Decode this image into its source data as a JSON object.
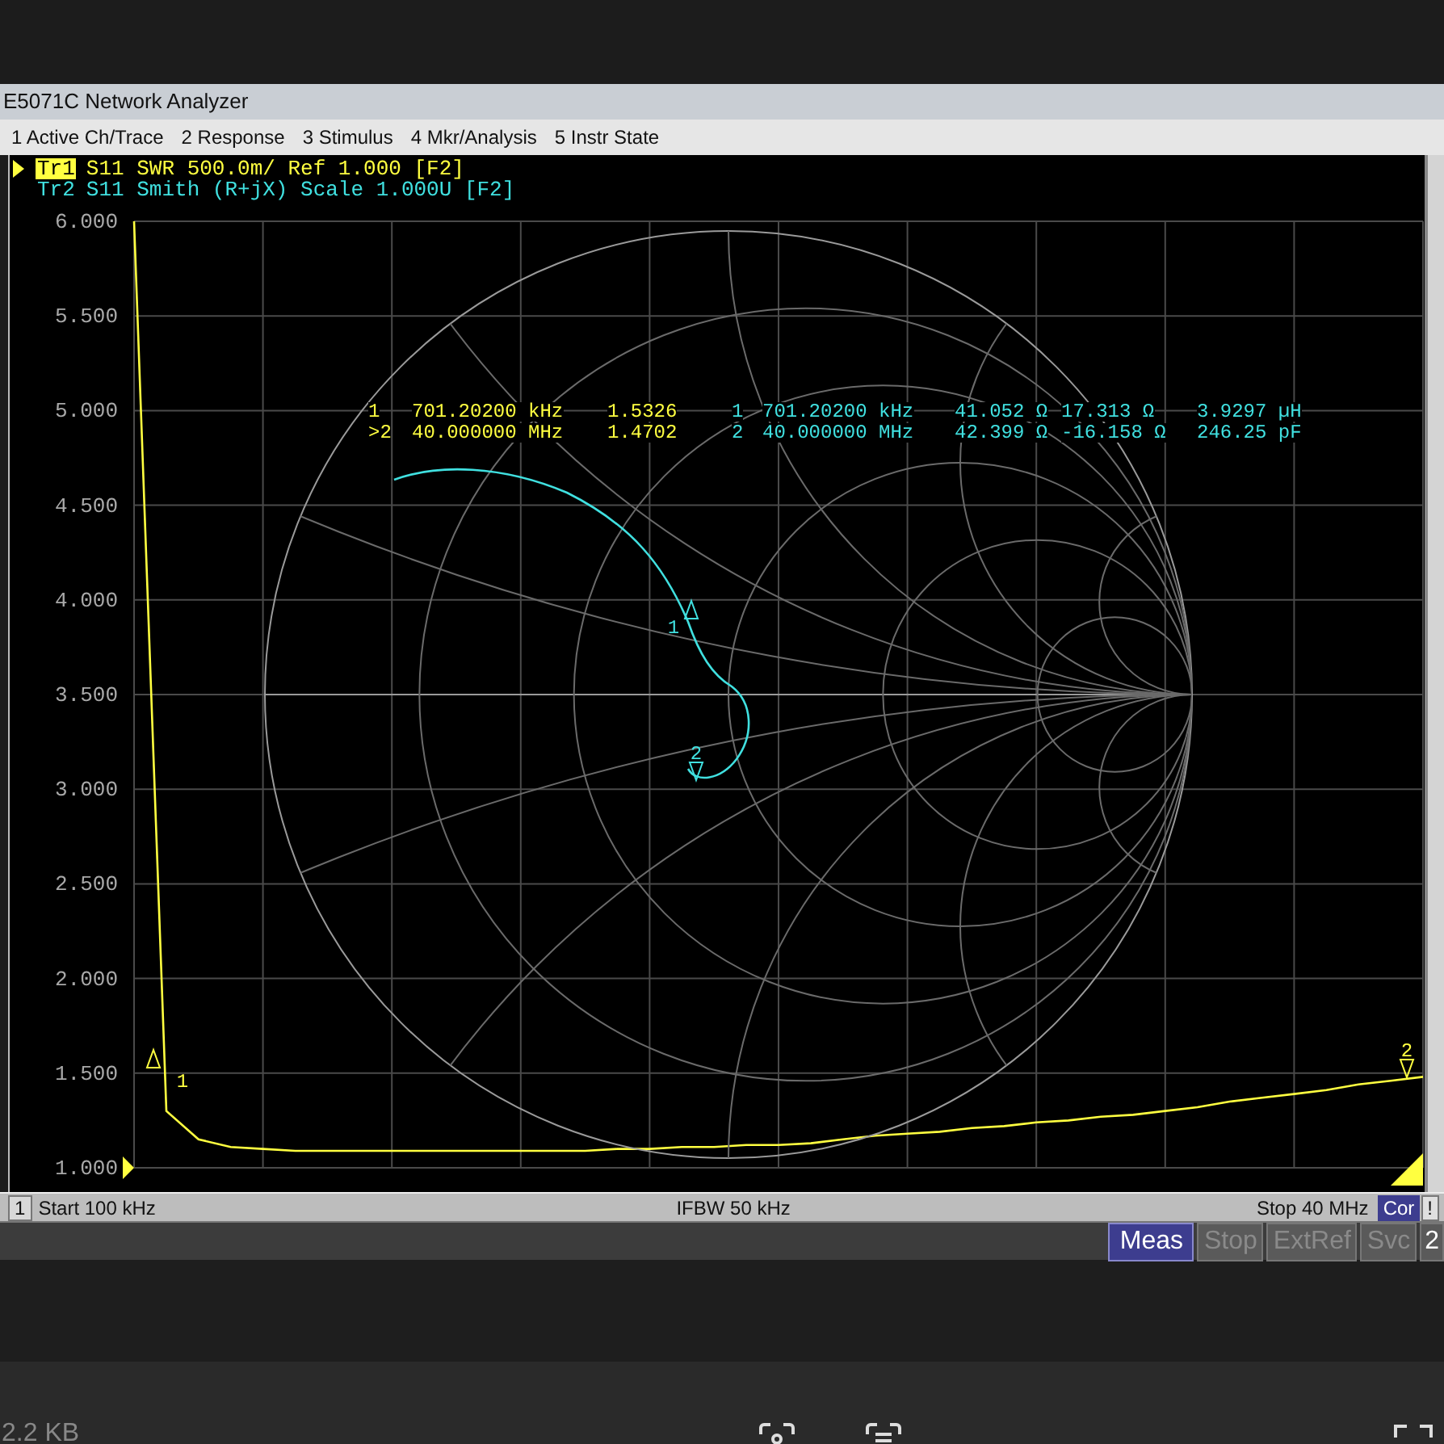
{
  "window": {
    "title": "E5071C Network Analyzer"
  },
  "menu": [
    {
      "label": "1 Active Ch/Trace"
    },
    {
      "label": "2 Response"
    },
    {
      "label": "3 Stimulus"
    },
    {
      "label": "4 Mkr/Analysis"
    },
    {
      "label": "5 Instr State"
    }
  ],
  "traces": [
    {
      "label": "Tr1",
      "text": "S11 SWR 500.0m/ Ref 1.000 [F2]",
      "selected": true,
      "color": "#ffff40"
    },
    {
      "label": "Tr2",
      "text": "S11 Smith (R+jX) Scale 1.000U [F2]",
      "selected": false,
      "color": "#40e0e0"
    }
  ],
  "tr1_markers": [
    {
      "number": "1",
      "frequency": "701.20200 kHz",
      "value": "1.5326"
    },
    {
      "number": ">2",
      "frequency": "40.000000 MHz",
      "value": "1.4702"
    }
  ],
  "tr2_markers": [
    {
      "number": "1",
      "frequency": "701.20200 kHz",
      "resistance": "41.052 Ω",
      "reactance": "17.313 Ω",
      "equivalent": "3.9297 µH"
    },
    {
      "number": "2",
      "frequency": "40.000000 MHz",
      "resistance": "42.399 Ω",
      "reactance": "-16.158 Ω",
      "equivalent": "246.25 pF"
    }
  ],
  "swr_chart": {
    "chart_data": {
      "type": "line",
      "grid": true,
      "ylim": [
        1,
        6
      ],
      "yticks": [
        {
          "value": 1,
          "label": "1.000"
        },
        {
          "value": 1.5,
          "label": "1.500"
        },
        {
          "value": 2,
          "label": "2.000"
        },
        {
          "value": 2.5,
          "label": "2.500"
        },
        {
          "value": 3,
          "label": "3.000"
        },
        {
          "value": 3.5,
          "label": "3.500"
        },
        {
          "value": 4,
          "label": "4.000"
        },
        {
          "value": 4.5,
          "label": "4.500"
        },
        {
          "value": 5,
          "label": "5.000"
        },
        {
          "value": 5.5,
          "label": "5.500"
        },
        {
          "value": 6,
          "label": "6.000"
        }
      ],
      "categories": [
        null,
        null,
        null,
        null,
        null,
        null,
        null,
        null,
        null,
        null,
        null,
        null,
        null,
        null,
        null,
        null,
        null,
        null,
        null,
        null,
        null,
        null,
        null,
        null,
        null,
        null,
        null,
        null,
        null,
        null,
        null,
        null,
        null,
        null,
        null,
        null,
        null,
        null,
        null,
        null,
        null
      ],
      "series": [
        {
          "color": "#ffff40",
          "values": [
            6.0,
            1.3,
            1.15,
            1.11,
            1.1,
            1.09,
            1.09,
            1.09,
            1.09,
            1.09,
            1.09,
            1.09,
            1.09,
            1.09,
            1.09,
            1.1,
            1.1,
            1.11,
            1.11,
            1.12,
            1.12,
            1.13,
            1.15,
            1.17,
            1.18,
            1.19,
            1.21,
            1.22,
            1.24,
            1.25,
            1.27,
            1.28,
            1.3,
            1.32,
            1.35,
            1.37,
            1.39,
            1.41,
            1.44,
            1.46,
            1.48
          ]
        }
      ]
    },
    "marker_labels": [
      "1",
      "2"
    ]
  },
  "smith_chart": {
    "marker_labels": [
      "1",
      "2"
    ]
  },
  "status_bar": {
    "channel": "1",
    "start": "Start 100 kHz",
    "ifbw": "IFBW 50 kHz",
    "stop": "Stop 40 MHz",
    "correction": "Cor",
    "alert": "!"
  },
  "instrument_bar": {
    "buttons": [
      {
        "label": "Meas",
        "selected": true
      },
      {
        "label": "Stop",
        "selected": false
      },
      {
        "label": "ExtRef",
        "selected": false
      },
      {
        "label": "Svc",
        "selected": false
      }
    ],
    "trailing": "2"
  },
  "viewer": {
    "file_size": "2.2 KB"
  }
}
